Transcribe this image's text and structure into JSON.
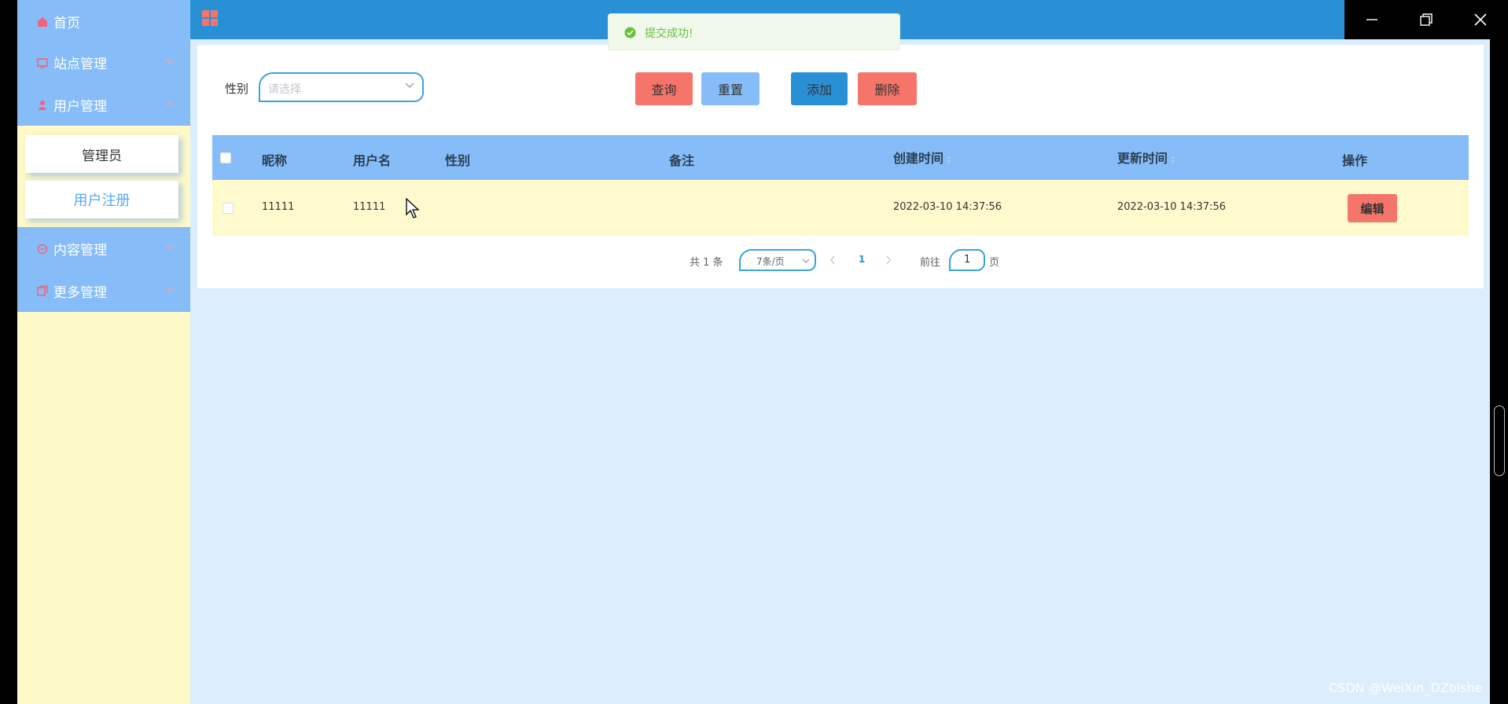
{
  "sidebar": {
    "items": [
      {
        "label": "首页",
        "icon": "home-icon"
      },
      {
        "label": "站点管理",
        "icon": "site-icon"
      },
      {
        "label": "用户管理",
        "icon": "user-icon"
      },
      {
        "label": "内容管理",
        "icon": "message-icon"
      },
      {
        "label": "更多管理",
        "icon": "copy-icon"
      }
    ],
    "submenu": [
      {
        "label": "管理员"
      },
      {
        "label": "用户注册"
      }
    ]
  },
  "colors": {
    "topbar": "#2a90d6",
    "sidebar_menu": "#86bdf9",
    "sidebar_bg": "#fefac8",
    "main_bg": "#dcedfd",
    "danger": "#f6756a",
    "primary": "#2a90d6",
    "light_blue": "#86bdf9",
    "row_bg": "#fefacd",
    "success": "#67c23a"
  },
  "toast": {
    "message": "提交成功!",
    "icon": "check-circle-icon"
  },
  "filter": {
    "gender_label": "性别",
    "gender_placeholder": "请选择"
  },
  "buttons": {
    "search": "查询",
    "reset": "重置",
    "add": "添加",
    "delete": "删除"
  },
  "table": {
    "headers": [
      "昵称",
      "用户名",
      "性别",
      "备注",
      "创建时间",
      "更新时间",
      "操作"
    ],
    "rows": [
      {
        "nickname": "11111",
        "username": "11111",
        "gender": "",
        "remark": "",
        "created": "2022-03-10 14:37:56",
        "updated": "2022-03-10 14:37:56",
        "action": "编辑"
      }
    ]
  },
  "pagination": {
    "total": "共 1 条",
    "page_size": "7条/页",
    "current_page": "1",
    "goto_label": "前往",
    "goto_value": "1",
    "page_unit": "页"
  },
  "watermark": "CSDN @WeiXin_DZbishe"
}
